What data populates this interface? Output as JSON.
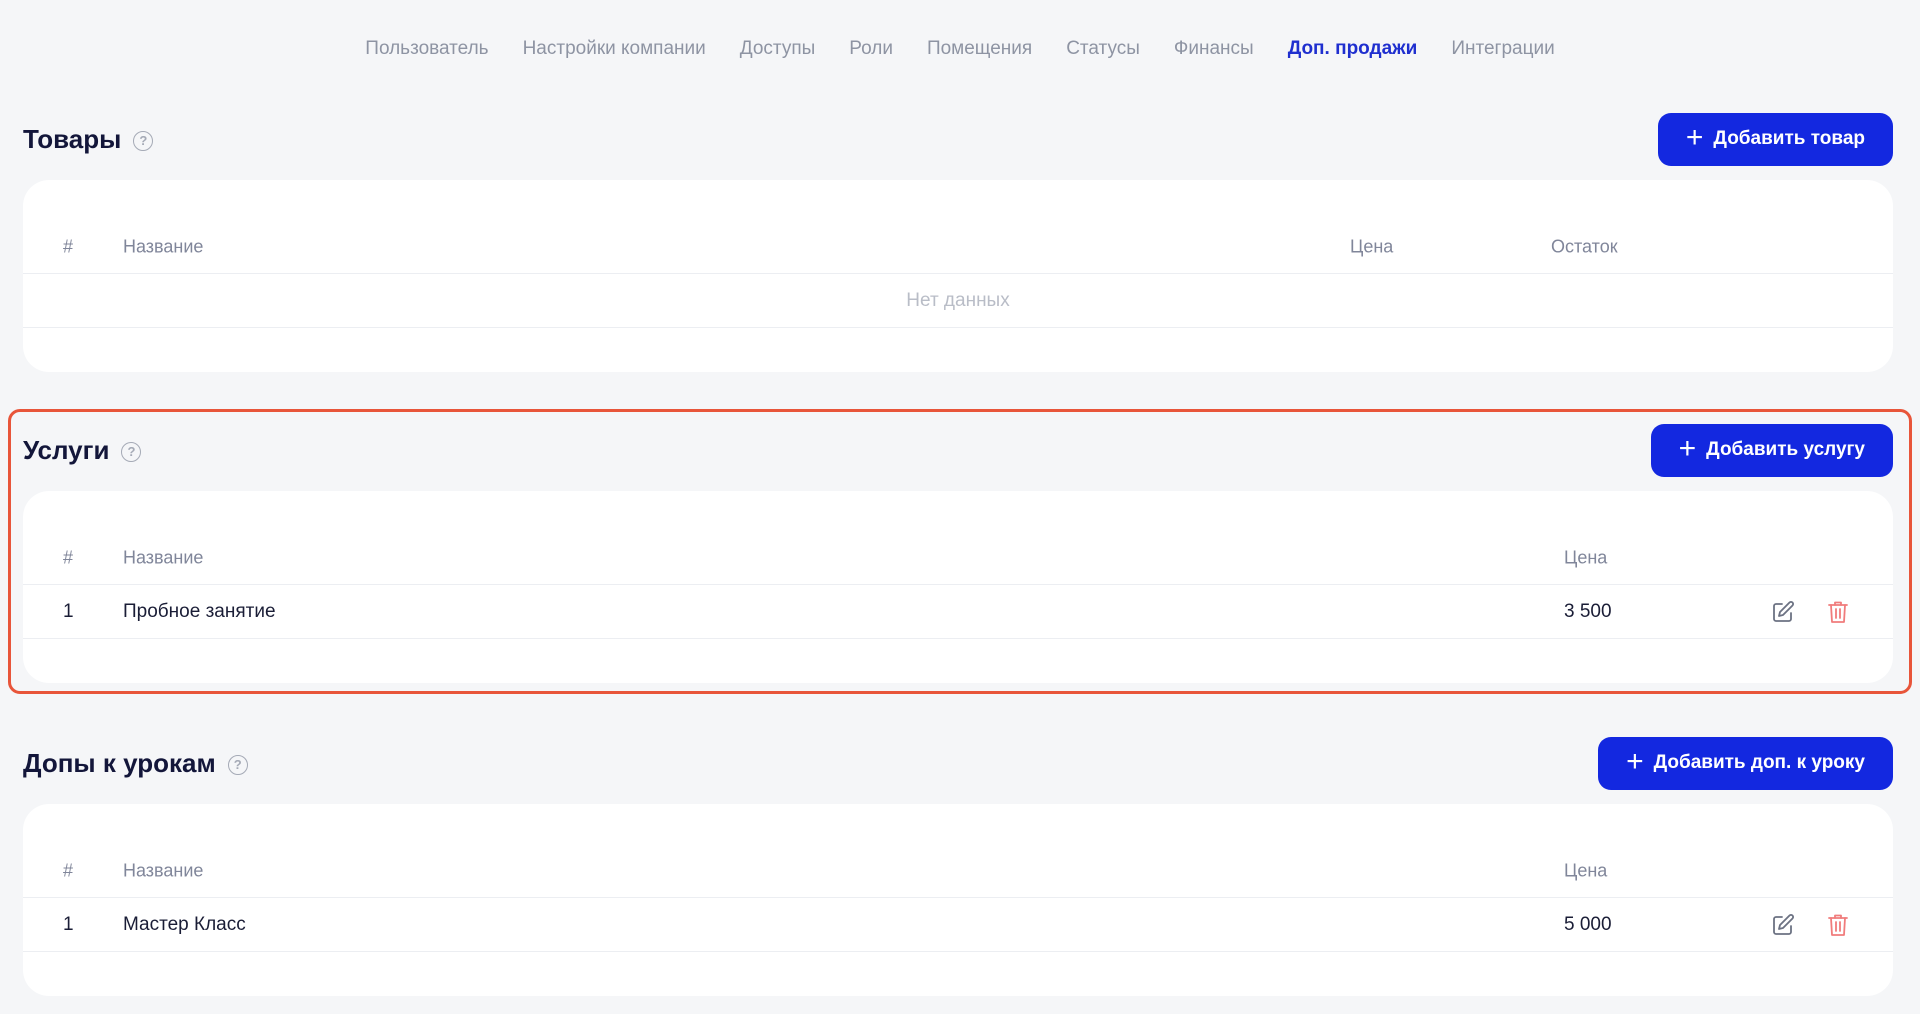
{
  "tabs": [
    {
      "label": "Пользователь"
    },
    {
      "label": "Настройки компании"
    },
    {
      "label": "Доступы"
    },
    {
      "label": "Роли"
    },
    {
      "label": "Помещения"
    },
    {
      "label": "Статусы"
    },
    {
      "label": "Финансы"
    },
    {
      "label": "Доп. продажи",
      "active": true
    },
    {
      "label": "Интеграции"
    }
  ],
  "products": {
    "title": "Товары",
    "help_icon": "question-circle",
    "add_label": "Добавить товар",
    "columns": {
      "num": "#",
      "name": "Название",
      "price": "Цена",
      "stock": "Остаток"
    },
    "empty_text": "Нет данных"
  },
  "services": {
    "title": "Услуги",
    "help_icon": "question-circle",
    "add_label": "Добавить услугу",
    "columns": {
      "num": "#",
      "name": "Название",
      "price": "Цена"
    },
    "rows": [
      {
        "num": "1",
        "name": "Пробное занятие",
        "price": "3 500"
      }
    ]
  },
  "lesson_extras": {
    "title": "Допы к урокам",
    "help_icon": "question-circle",
    "add_label": "Добавить доп. к уроку",
    "columns": {
      "num": "#",
      "name": "Название",
      "price": "Цена"
    },
    "rows": [
      {
        "num": "1",
        "name": "Мастер Класс",
        "price": "5 000"
      }
    ]
  },
  "colors": {
    "accent": "#1328e0",
    "active_tab": "#1f2fcf",
    "highlight": "#e8553a",
    "delete": "#f07c7c"
  }
}
